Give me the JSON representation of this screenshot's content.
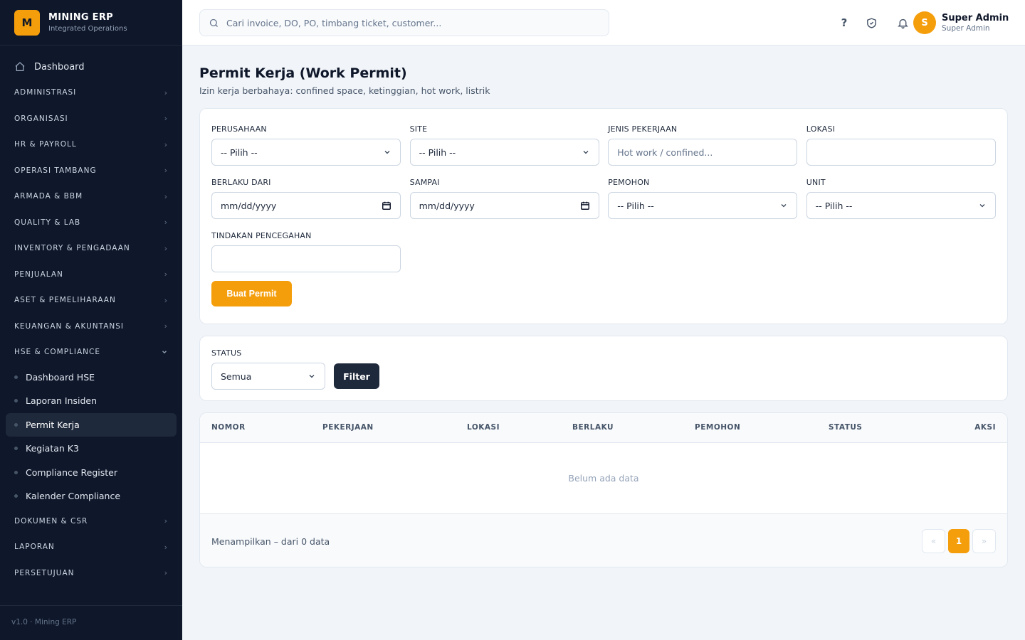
{
  "brand": {
    "logo_letter": "M",
    "name": "MINING ERP",
    "subtitle": "Integrated Operations"
  },
  "sidebar": {
    "dashboard_label": "Dashboard",
    "groups_top": [
      {
        "label": "ADMINISTRASI"
      },
      {
        "label": "ORGANISASI"
      },
      {
        "label": "HR & PAYROLL"
      },
      {
        "label": "OPERASI TAMBANG"
      },
      {
        "label": "ARMADA & BBM"
      },
      {
        "label": "QUALITY & LAB"
      },
      {
        "label": "INVENTORY & PENGADAAN"
      },
      {
        "label": "PENJUALAN"
      },
      {
        "label": "ASET & PEMELIHARAAN"
      },
      {
        "label": "KEUANGAN & AKUNTANSI"
      }
    ],
    "open_group": {
      "label": "HSE & COMPLIANCE",
      "items": [
        {
          "label": "Dashboard HSE",
          "active": false
        },
        {
          "label": "Laporan Insiden",
          "active": false
        },
        {
          "label": "Permit Kerja",
          "active": true
        },
        {
          "label": "Kegiatan K3",
          "active": false
        },
        {
          "label": "Compliance Register",
          "active": false
        },
        {
          "label": "Kalender Compliance",
          "active": false
        }
      ]
    },
    "groups_bottom": [
      {
        "label": "DOKUMEN & CSR"
      },
      {
        "label": "LAPORAN"
      },
      {
        "label": "PERSETUJUAN"
      }
    ],
    "footer": "v1.0 · Mining ERP"
  },
  "topbar": {
    "search_placeholder": "Cari invoice, DO, PO, timbang ticket, customer...",
    "help_glyph": "?",
    "user": {
      "initial": "S",
      "name": "Super Admin",
      "role": "Super Admin"
    }
  },
  "page": {
    "title": "Permit Kerja (Work Permit)",
    "subtitle": "Izin kerja berbahaya: confined space, ketinggian, hot work, listrik"
  },
  "form": {
    "fields": [
      {
        "label": "PERUSAHAAN",
        "value": "-- Pilih --",
        "type": "select"
      },
      {
        "label": "SITE",
        "value": "-- Pilih --",
        "type": "select"
      },
      {
        "label": "JENIS PEKERJAAN",
        "value": "Hot work / confined...",
        "type": "placeholder"
      },
      {
        "label": "LOKASI",
        "value": "",
        "type": "text"
      },
      {
        "label": "BERLAKU DARI",
        "value": "mm/dd/yyyy",
        "type": "date"
      },
      {
        "label": "SAMPAI",
        "value": "mm/dd/yyyy",
        "type": "date"
      },
      {
        "label": "PEMOHON",
        "value": "-- Pilih --",
        "type": "select"
      },
      {
        "label": "UNIT",
        "value": "-- Pilih --",
        "type": "select"
      },
      {
        "label": "TINDAKAN PENCEGAHAN",
        "value": "",
        "type": "text"
      }
    ],
    "submit_label": "Buat Permit"
  },
  "filter": {
    "status_label": "STATUS",
    "status_value": "Semua",
    "button_label": "Filter"
  },
  "table": {
    "columns": [
      "NOMOR",
      "PEKERJAAN",
      "LOKASI",
      "BERLAKU",
      "PEMOHON",
      "STATUS",
      "AKSI"
    ],
    "empty_text": "Belum ada data",
    "footer_info": "Menampilkan – dari 0 data",
    "pagination": {
      "prev": "«",
      "current": "1",
      "next": "»"
    }
  },
  "colors": {
    "accent": "#f59e0b",
    "sidebar_bg": "#0f172a",
    "dark_button": "#1e293b"
  }
}
